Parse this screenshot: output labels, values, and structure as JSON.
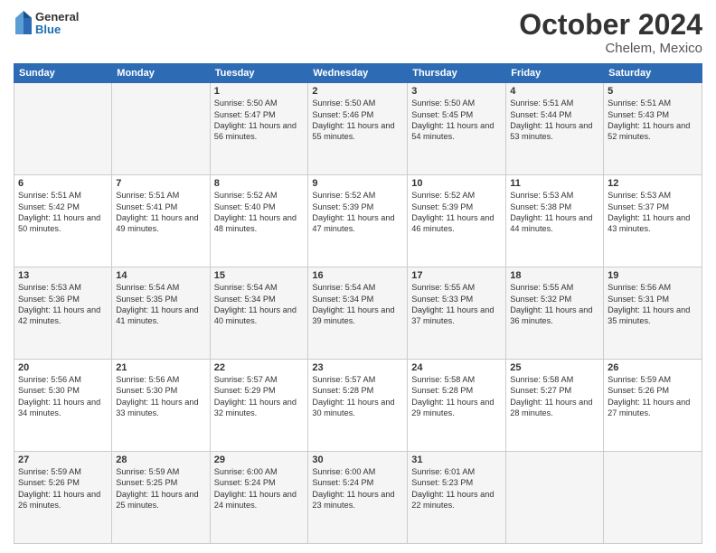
{
  "header": {
    "logo": {
      "line1": "General",
      "line2": "Blue"
    },
    "month": "October 2024",
    "location": "Chelem, Mexico"
  },
  "weekdays": [
    "Sunday",
    "Monday",
    "Tuesday",
    "Wednesday",
    "Thursday",
    "Friday",
    "Saturday"
  ],
  "weeks": [
    [
      {
        "day": "",
        "info": ""
      },
      {
        "day": "",
        "info": ""
      },
      {
        "day": "1",
        "info": "Sunrise: 5:50 AM\nSunset: 5:47 PM\nDaylight: 11 hours and 56 minutes."
      },
      {
        "day": "2",
        "info": "Sunrise: 5:50 AM\nSunset: 5:46 PM\nDaylight: 11 hours and 55 minutes."
      },
      {
        "day": "3",
        "info": "Sunrise: 5:50 AM\nSunset: 5:45 PM\nDaylight: 11 hours and 54 minutes."
      },
      {
        "day": "4",
        "info": "Sunrise: 5:51 AM\nSunset: 5:44 PM\nDaylight: 11 hours and 53 minutes."
      },
      {
        "day": "5",
        "info": "Sunrise: 5:51 AM\nSunset: 5:43 PM\nDaylight: 11 hours and 52 minutes."
      }
    ],
    [
      {
        "day": "6",
        "info": "Sunrise: 5:51 AM\nSunset: 5:42 PM\nDaylight: 11 hours and 50 minutes."
      },
      {
        "day": "7",
        "info": "Sunrise: 5:51 AM\nSunset: 5:41 PM\nDaylight: 11 hours and 49 minutes."
      },
      {
        "day": "8",
        "info": "Sunrise: 5:52 AM\nSunset: 5:40 PM\nDaylight: 11 hours and 48 minutes."
      },
      {
        "day": "9",
        "info": "Sunrise: 5:52 AM\nSunset: 5:39 PM\nDaylight: 11 hours and 47 minutes."
      },
      {
        "day": "10",
        "info": "Sunrise: 5:52 AM\nSunset: 5:39 PM\nDaylight: 11 hours and 46 minutes."
      },
      {
        "day": "11",
        "info": "Sunrise: 5:53 AM\nSunset: 5:38 PM\nDaylight: 11 hours and 44 minutes."
      },
      {
        "day": "12",
        "info": "Sunrise: 5:53 AM\nSunset: 5:37 PM\nDaylight: 11 hours and 43 minutes."
      }
    ],
    [
      {
        "day": "13",
        "info": "Sunrise: 5:53 AM\nSunset: 5:36 PM\nDaylight: 11 hours and 42 minutes."
      },
      {
        "day": "14",
        "info": "Sunrise: 5:54 AM\nSunset: 5:35 PM\nDaylight: 11 hours and 41 minutes."
      },
      {
        "day": "15",
        "info": "Sunrise: 5:54 AM\nSunset: 5:34 PM\nDaylight: 11 hours and 40 minutes."
      },
      {
        "day": "16",
        "info": "Sunrise: 5:54 AM\nSunset: 5:34 PM\nDaylight: 11 hours and 39 minutes."
      },
      {
        "day": "17",
        "info": "Sunrise: 5:55 AM\nSunset: 5:33 PM\nDaylight: 11 hours and 37 minutes."
      },
      {
        "day": "18",
        "info": "Sunrise: 5:55 AM\nSunset: 5:32 PM\nDaylight: 11 hours and 36 minutes."
      },
      {
        "day": "19",
        "info": "Sunrise: 5:56 AM\nSunset: 5:31 PM\nDaylight: 11 hours and 35 minutes."
      }
    ],
    [
      {
        "day": "20",
        "info": "Sunrise: 5:56 AM\nSunset: 5:30 PM\nDaylight: 11 hours and 34 minutes."
      },
      {
        "day": "21",
        "info": "Sunrise: 5:56 AM\nSunset: 5:30 PM\nDaylight: 11 hours and 33 minutes."
      },
      {
        "day": "22",
        "info": "Sunrise: 5:57 AM\nSunset: 5:29 PM\nDaylight: 11 hours and 32 minutes."
      },
      {
        "day": "23",
        "info": "Sunrise: 5:57 AM\nSunset: 5:28 PM\nDaylight: 11 hours and 30 minutes."
      },
      {
        "day": "24",
        "info": "Sunrise: 5:58 AM\nSunset: 5:28 PM\nDaylight: 11 hours and 29 minutes."
      },
      {
        "day": "25",
        "info": "Sunrise: 5:58 AM\nSunset: 5:27 PM\nDaylight: 11 hours and 28 minutes."
      },
      {
        "day": "26",
        "info": "Sunrise: 5:59 AM\nSunset: 5:26 PM\nDaylight: 11 hours and 27 minutes."
      }
    ],
    [
      {
        "day": "27",
        "info": "Sunrise: 5:59 AM\nSunset: 5:26 PM\nDaylight: 11 hours and 26 minutes."
      },
      {
        "day": "28",
        "info": "Sunrise: 5:59 AM\nSunset: 5:25 PM\nDaylight: 11 hours and 25 minutes."
      },
      {
        "day": "29",
        "info": "Sunrise: 6:00 AM\nSunset: 5:24 PM\nDaylight: 11 hours and 24 minutes."
      },
      {
        "day": "30",
        "info": "Sunrise: 6:00 AM\nSunset: 5:24 PM\nDaylight: 11 hours and 23 minutes."
      },
      {
        "day": "31",
        "info": "Sunrise: 6:01 AM\nSunset: 5:23 PM\nDaylight: 11 hours and 22 minutes."
      },
      {
        "day": "",
        "info": ""
      },
      {
        "day": "",
        "info": ""
      }
    ]
  ]
}
